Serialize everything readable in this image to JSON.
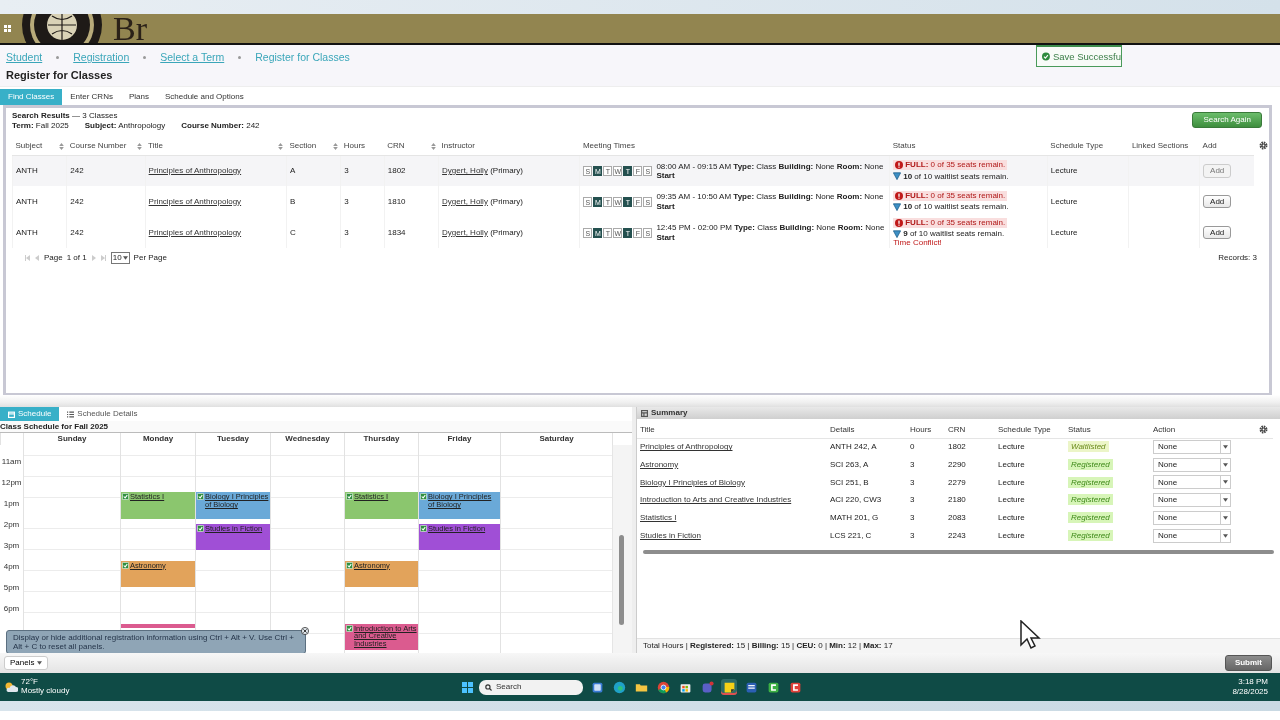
{
  "header": {
    "logo_text": "Br"
  },
  "breadcrumbs": [
    {
      "label": "Student",
      "link": true
    },
    {
      "label": "Registration",
      "link": true
    },
    {
      "label": "Select a Term",
      "link": true
    },
    {
      "label": "Register for Classes",
      "link": false
    }
  ],
  "page_title": "Register for Classes",
  "toast": {
    "text": "Save Successfu"
  },
  "tabs": [
    {
      "label": "Find Classes",
      "selected": true
    },
    {
      "label": "Enter CRNs",
      "selected": false
    },
    {
      "label": "Plans",
      "selected": false
    },
    {
      "label": "Schedule and Options",
      "selected": false
    }
  ],
  "search": {
    "title": "Search Results",
    "count": "— 3 Classes",
    "criteria": [
      "**Term:** Fall 2025",
      "**Subject:** Anthropology",
      "**Course Number:** 242"
    ],
    "search_again": "Search Again",
    "columns": [
      {
        "label": "Subject",
        "sortable": true
      },
      {
        "label": "Course Number",
        "sortable": true
      },
      {
        "label": "Title",
        "sortable": true
      },
      {
        "label": "Section",
        "sortable": true
      },
      {
        "label": "Hours",
        "sortable": false
      },
      {
        "label": "CRN",
        "sortable": true
      },
      {
        "label": "Instructor",
        "sortable": false
      },
      {
        "label": "Meeting Times",
        "sortable": false
      },
      {
        "label": "Status",
        "sortable": false
      },
      {
        "label": "Schedule Type",
        "sortable": false
      },
      {
        "label": "Linked Sections",
        "sortable": false
      },
      {
        "label": "Add",
        "sortable": false
      }
    ],
    "rows": [
      {
        "subject": "ANTH",
        "course_number": "242",
        "title": "Principles of Anthropology",
        "section": "A",
        "hours": "3",
        "crn": "1802",
        "instructor": "Dygert, Holly",
        "instructor_role": "(Primary)",
        "days": [
          {
            "label": "S",
            "on": false
          },
          {
            "label": "M",
            "on": true
          },
          {
            "label": "T",
            "on": false
          },
          {
            "label": "W",
            "on": false
          },
          {
            "label": "T",
            "on": true
          },
          {
            "label": "F",
            "on": false
          },
          {
            "label": "S",
            "on": false
          }
        ],
        "meeting": "08:00 AM - 09:15 AM **Type:** Class **Building:** None **Room:** None **Start**",
        "seats": "**FULL:** 0 of 35 seats remain.",
        "waitlist": "**10** of 10 waitlist seats remain.",
        "schedule_type": "Lecture",
        "add": {
          "label": "Add",
          "disabled": true
        }
      },
      {
        "subject": "ANTH",
        "course_number": "242",
        "title": "Principles of Anthropology",
        "section": "B",
        "hours": "3",
        "crn": "1810",
        "instructor": "Dygert, Holly",
        "instructor_role": "(Primary)",
        "days": [
          {
            "label": "S",
            "on": false
          },
          {
            "label": "M",
            "on": true
          },
          {
            "label": "T",
            "on": false
          },
          {
            "label": "W",
            "on": false
          },
          {
            "label": "T",
            "on": true
          },
          {
            "label": "F",
            "on": false
          },
          {
            "label": "S",
            "on": false
          }
        ],
        "meeting": "09:35 AM - 10:50 AM **Type:** Class **Building:** None **Room:** None **Start**",
        "seats": "**FULL:** 0 of 35 seats remain.",
        "waitlist": "**10** of 10 waitlist seats remain.",
        "schedule_type": "Lecture",
        "add": {
          "label": "Add",
          "disabled": false
        }
      },
      {
        "subject": "ANTH",
        "course_number": "242",
        "title": "Principles of Anthropology",
        "section": "C",
        "hours": "3",
        "crn": "1834",
        "instructor": "Dygert, Holly",
        "instructor_role": "(Primary)",
        "days": [
          {
            "label": "S",
            "on": false
          },
          {
            "label": "M",
            "on": true
          },
          {
            "label": "T",
            "on": false
          },
          {
            "label": "W",
            "on": false
          },
          {
            "label": "T",
            "on": true
          },
          {
            "label": "F",
            "on": false
          },
          {
            "label": "S",
            "on": false
          }
        ],
        "meeting": "12:45 PM - 02:00 PM **Type:** Class **Building:** None **Room:** None **Start**",
        "seats": "**FULL:** 0 of 35 seats remain.",
        "waitlist": "**9** of 10 waitlist seats remain.",
        "conflict": "Time Conflict!",
        "schedule_type": "Lecture",
        "add": {
          "label": "Add",
          "disabled": false
        }
      }
    ],
    "pager": {
      "page_label": "Page",
      "page": "1 of 1",
      "per_page": "10",
      "per_page_label": "Per Page",
      "records": "Records: 3"
    }
  },
  "schedule": {
    "tabs": [
      {
        "label": "Schedule",
        "selected": true
      },
      {
        "label": "Schedule Details",
        "selected": false
      }
    ],
    "heading": "Class Schedule for Fall 2025",
    "hours": [
      "11am",
      "12pm",
      "1pm",
      "2pm",
      "3pm",
      "4pm",
      "5pm",
      "6pm"
    ],
    "days": [
      {
        "label": "Sunday"
      },
      {
        "label": "Monday",
        "events": [
          {
            "title": "Statistics I",
            "color": "#8bc66e"
          },
          {
            "title": "Astronomy",
            "color": "#e2a35b"
          },
          {
            "color": "#db5b8f"
          }
        ]
      },
      {
        "label": "Tuesday",
        "events": [
          {
            "title": "Biology I Principles of Biology",
            "color": "#6aa9d8"
          },
          {
            "title": "Studies in Fiction",
            "color": "#a04fd6"
          }
        ]
      },
      {
        "label": "Wednesday"
      },
      {
        "label": "Thursday",
        "events": [
          {
            "title": "Statistics I",
            "color": "#8bc66e"
          },
          {
            "title": "Astronomy",
            "color": "#e2a35b"
          },
          {
            "title": "Introduction to Arts and Creative Industries",
            "color": "#db5b8f"
          }
        ]
      },
      {
        "label": "Friday",
        "events": [
          {
            "title": "Biology I Principles of Biology",
            "color": "#6aa9d8"
          },
          {
            "title": "Studies in Fiction",
            "color": "#a04fd6"
          }
        ]
      },
      {
        "label": "Saturday"
      }
    ],
    "tooltip": "Display or hide additional registration information using Ctrl + Alt + V. Use Ctrl + Alt + C to reset all panels."
  },
  "summary": {
    "title": "Summary",
    "columns": [
      "Title",
      "Details",
      "Hours",
      "CRN",
      "Schedule Type",
      "Status",
      "Action"
    ],
    "rows": [
      {
        "title": "Principles of Anthropology",
        "details": "ANTH 242, A",
        "hours": "0",
        "crn": "1802",
        "schedule_type": "Lecture",
        "status": "Waitlisted",
        "kind": "waitlisted",
        "action": "None"
      },
      {
        "title": "Astronomy",
        "details": "SCI 263, A",
        "hours": "3",
        "crn": "2290",
        "schedule_type": "Lecture",
        "status": "Registered",
        "kind": "registered",
        "action": "None"
      },
      {
        "title": "Biology I Principles of Biology",
        "details": "SCI 251, B",
        "hours": "3",
        "crn": "2279",
        "schedule_type": "Lecture",
        "status": "Registered",
        "kind": "registered",
        "action": "None"
      },
      {
        "title": "Introduction to Arts and Creative Industries",
        "details": "ACI 220, CW3",
        "hours": "3",
        "crn": "2180",
        "schedule_type": "Lecture",
        "status": "Registered",
        "kind": "registered",
        "action": "None"
      },
      {
        "title": "Statistics I",
        "details": "MATH 201, G",
        "hours": "3",
        "crn": "2083",
        "schedule_type": "Lecture",
        "status": "Registered",
        "kind": "registered",
        "action": "None"
      },
      {
        "title": "Studies in Fiction",
        "details": "LCS 221, C",
        "hours": "3",
        "crn": "2243",
        "schedule_type": "Lecture",
        "status": "Registered",
        "kind": "registered",
        "action": "None"
      }
    ],
    "totals": "Total Hours | **Registered:** 15 | **Billing:** 15 | **CEU:** 0 | **Min:** 12 | **Max:** 17"
  },
  "footer": {
    "panels": "Panels",
    "submit": "Submit"
  },
  "taskbar": {
    "temperature": "72°F",
    "weather": "Mostly cloudy",
    "search": "Search",
    "time": "3:18 PM",
    "date": "8/28/2025",
    "apps": [
      {
        "kind": "widgets",
        "active": false
      },
      {
        "kind": "edge",
        "active": false
      },
      {
        "kind": "folder",
        "active": false
      },
      {
        "kind": "chrome",
        "active": false
      },
      {
        "kind": "store",
        "active": false
      },
      {
        "kind": "teams",
        "active": false
      },
      {
        "kind": "notes",
        "active": true
      },
      {
        "kind": "word",
        "active": false
      },
      {
        "kind": "green",
        "active": false
      },
      {
        "kind": "red",
        "active": false
      }
    ]
  }
}
